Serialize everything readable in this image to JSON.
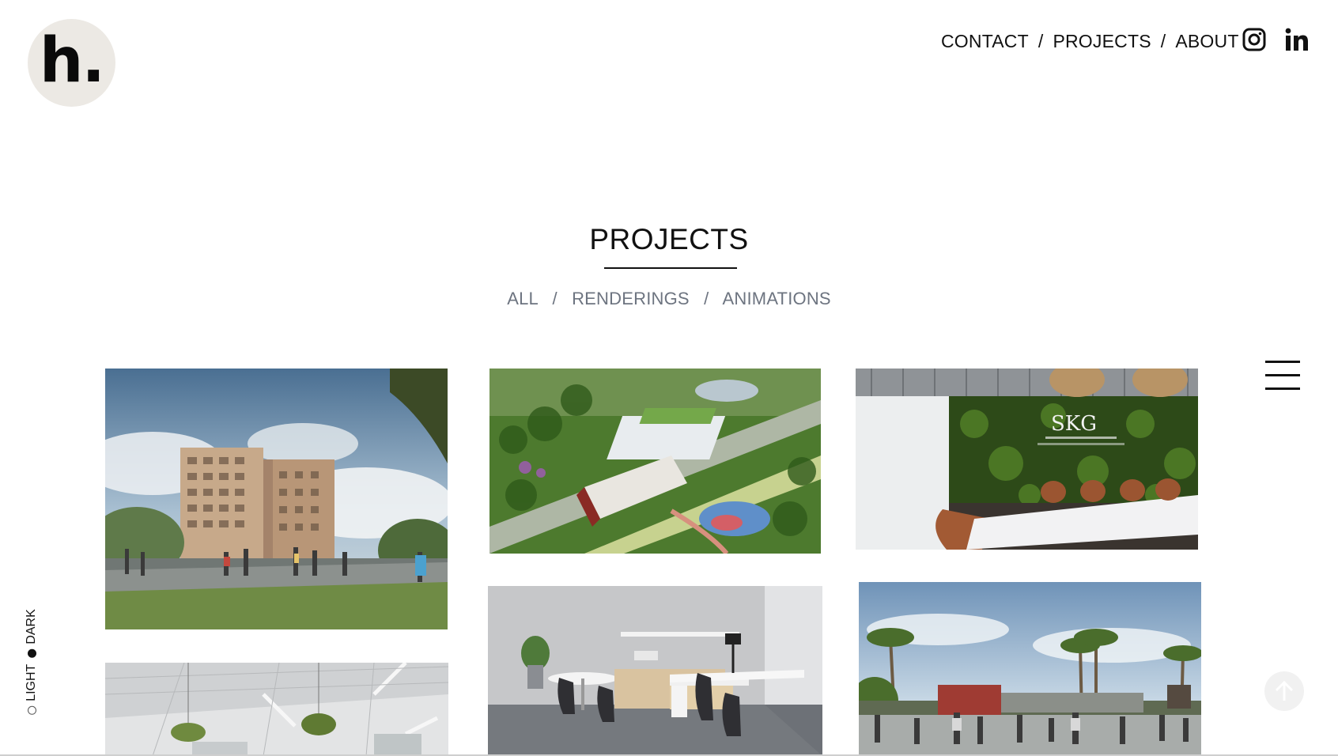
{
  "logo": {
    "text": "h."
  },
  "nav": {
    "links": [
      "CONTACT",
      "PROJECTS",
      "ABOUT"
    ],
    "separator": "/"
  },
  "social": [
    "instagram-icon",
    "linkedin-icon"
  ],
  "page": {
    "title": "PROJECTS"
  },
  "filters": {
    "items": [
      "ALL",
      "RENDERINGS",
      "ANIMATIONS"
    ],
    "separator": "/"
  },
  "theme": {
    "light_label": "LIGHT",
    "dark_label": "DARK",
    "selected": "DARK"
  },
  "gallery": {
    "tiles": [
      {
        "name": "tile-residential-tower"
      },
      {
        "name": "tile-aerial-campus"
      },
      {
        "name": "tile-office-green-wall"
      },
      {
        "name": "tile-warehouse-interior"
      },
      {
        "name": "tile-office-workstation"
      },
      {
        "name": "tile-plaza-palms"
      }
    ],
    "green_wall_sign": "SKG"
  },
  "colors": {
    "logo_bg": "#ece9e4",
    "text": "#111111",
    "filter_text": "#6d7480"
  }
}
